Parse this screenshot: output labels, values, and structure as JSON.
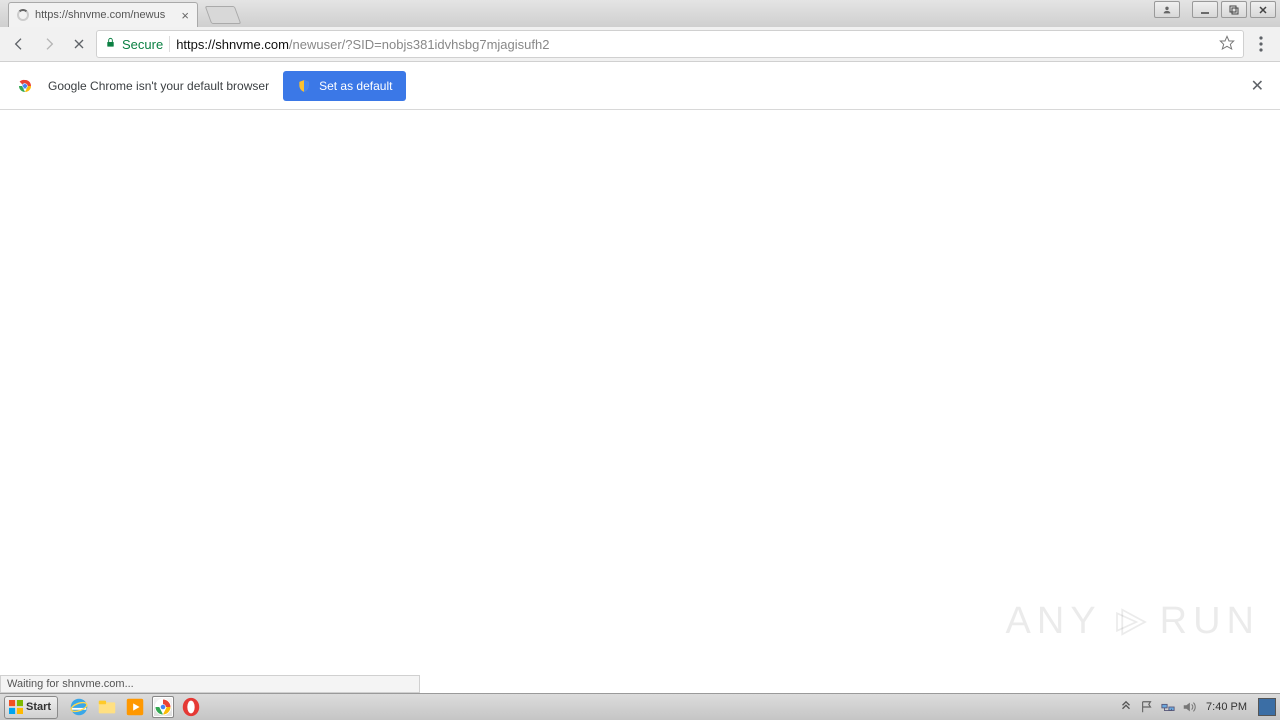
{
  "window": {
    "tab_title": "https://shnvme.com/newus",
    "user_icon": "user-icon"
  },
  "toolbar": {
    "secure_label": "Secure",
    "url_scheme": "https",
    "url_host": "://shnvme.com",
    "url_path": "/newuser/?SID=nobjs381idvhsbg7mjagisufh2"
  },
  "infobar": {
    "message": "Google Chrome isn't your default browser",
    "button_label": "Set as default"
  },
  "status": {
    "text": "Waiting for shnvme.com..."
  },
  "watermark": {
    "text_left": "ANY",
    "text_right": "RUN"
  },
  "taskbar": {
    "start_label": "Start",
    "clock": "7:40 PM"
  }
}
